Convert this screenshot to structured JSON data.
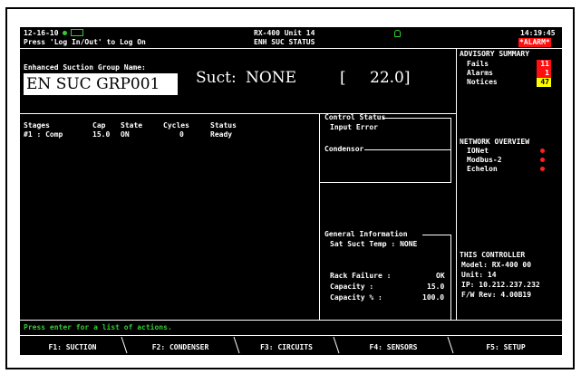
{
  "header": {
    "date": "12-16-10",
    "login_prompt": "Press 'Log In/Out' to Log On",
    "unit": "RX-400 Unit 14",
    "screen_name": "ENH SUC STATUS",
    "time": "14:19:45",
    "alarm_label": "*ALARM*",
    "colors": {
      "status_dot": "#33cc33",
      "alarm_bg": "#ff1010"
    }
  },
  "group": {
    "name_label": "Enhanced Suction Group Name:",
    "name_value": "EN SUC GRP001",
    "suct_label": "Suct:",
    "suct_value": "NONE",
    "bracket_open": "[",
    "bracket_value": "22.0]"
  },
  "stages_table": {
    "headers": [
      "Stages",
      "Cap",
      "State",
      "Cycles",
      "Status"
    ],
    "rows": [
      [
        "#1 : Comp",
        "15.0",
        "ON",
        "0",
        "Ready"
      ]
    ]
  },
  "control_status": {
    "title": "Control Status",
    "value": "Input Error"
  },
  "condensor": {
    "title": "Condensor"
  },
  "general_info": {
    "title": "General Information",
    "sat_suct_temp": "Sat Suct Temp : NONE",
    "rack_failure_label": "Rack Failure :",
    "rack_failure_value": "OK",
    "capacity_label": "Capacity :",
    "capacity_value": "15.0",
    "capacity_pct_label": "Capacity % :",
    "capacity_pct_value": "100.0"
  },
  "advisory": {
    "title": "ADVISORY SUMMARY",
    "items": [
      {
        "label": "Fails",
        "count": "11",
        "color": "#ff1010"
      },
      {
        "label": "Alarms",
        "count": "1",
        "color": "#ff1010"
      },
      {
        "label": "Notices",
        "count": "47",
        "color": "#ffff00"
      }
    ]
  },
  "network": {
    "title": "NETWORK OVERVIEW",
    "items": [
      "IONet",
      "Modbus-2",
      "Echelon"
    ]
  },
  "controller": {
    "title": "THIS CONTROLLER",
    "model": "Model: RX-400 00",
    "unit": "Unit: 14",
    "ip": "IP: 10.212.237.232",
    "fw": "F/W Rev: 4.00B19"
  },
  "footer": {
    "prompt": "Press enter for a list of actions.",
    "fkeys": [
      "F1: SUCTION",
      "F2: CONDENSER",
      "F3: CIRCUITS",
      "F4: SENSORS",
      "F5: SETUP"
    ],
    "colors": {
      "prompt": "#33cc33"
    }
  }
}
